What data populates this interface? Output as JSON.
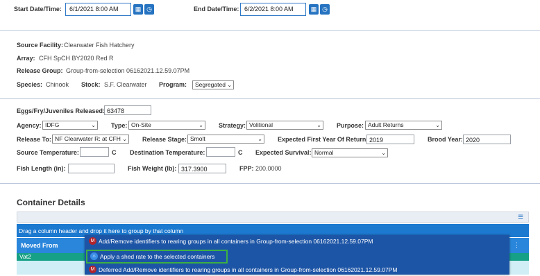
{
  "dates": {
    "start_label": "Start Date/Time:",
    "start_value": "6/1/2021 8:00 AM",
    "end_label": "End Date/Time:",
    "end_value": "6/2/2021 8:00 AM"
  },
  "source": {
    "facility_label": "Source Facility:",
    "facility_value": "Clearwater Fish Hatchery",
    "array_label": "Array:",
    "array_value": "CFH SpCH BY2020 Red R",
    "group_label": "Release Group:",
    "group_value": "Group-from-selection 06162021.12.59.07PM",
    "species_label": "Species:",
    "species_value": "Chinook",
    "stock_label": "Stock:",
    "stock_value": "S.F. Clearwater",
    "program_label": "Program:",
    "program_value": "Segregated"
  },
  "release": {
    "released_label": "Eggs/Fry/Juveniles Released:",
    "released_value": "63478",
    "agency_label": "Agency:",
    "agency_value": "IDFG",
    "type_label": "Type:",
    "type_value": "On-Site",
    "strategy_label": "Strategy:",
    "strategy_value": "Volitional",
    "purpose_label": "Purpose:",
    "purpose_value": "Adult Returns",
    "release_to_label": "Release To:",
    "release_to_value": "NF Clearwater R: at CFH",
    "stage_label": "Release Stage:",
    "stage_value": "Smolt",
    "first_year_label": "Expected First Year Of Return:",
    "first_year_value": "2019",
    "brood_label": "Brood Year:",
    "brood_value": "2020",
    "src_temp_label": "Source Temperature:",
    "src_temp_unit": "C",
    "dst_temp_label": "Destination Temperature:",
    "dst_temp_unit": "C",
    "survival_label": "Expected Survival:",
    "survival_value": "Normal",
    "length_label": "Fish Length  (in):",
    "weight_label": "Fish Weight  (lb):",
    "weight_value": "317.3900",
    "fpp_label": "FPP:",
    "fpp_value": "200.0000"
  },
  "containers": {
    "title": "Container Details",
    "group_hint": "Drag a column header and drop it here to group by that column",
    "col_moved_from": "Moved From",
    "row1_moved_from": "Vat2"
  },
  "context_menu": {
    "items": [
      {
        "label": "Add/Remove identifiers to rearing groups in all containers in Group-from-selection 06162021.12.59.07PM",
        "icon": "m-circle-icon"
      },
      {
        "label": "Apply a shed rate to the selected containers",
        "icon": "fish-shed-icon"
      },
      {
        "label": "Deferred Add/Remove identifiers to rearing groups in all containers in Group-from-selection 06162021.12.59.07PM",
        "icon": "m-circle-icon"
      }
    ]
  },
  "colors": {
    "accent": "#2573c1",
    "menu_bg": "#1d55a6",
    "highlight_border": "#3cb043",
    "row_selected": "#16a085"
  }
}
